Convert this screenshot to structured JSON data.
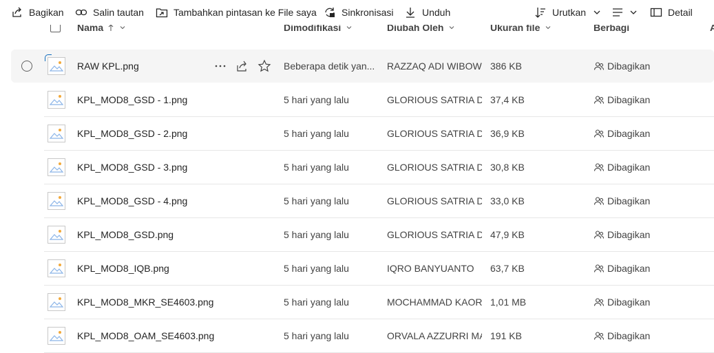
{
  "toolbar": {
    "share": "Bagikan",
    "copy_link": "Salin tautan",
    "add_shortcut": "Tambahkan pintasan ke File saya",
    "sync": "Sinkronisasi",
    "download": "Unduh",
    "sort": "Urutkan",
    "view_icon": "list-view-icon",
    "details": "Detail"
  },
  "columns": {
    "name": "Nama",
    "modified": "Dimodifikasi",
    "modified_by": "Diubah Oleh",
    "size": "Ukuran file",
    "sharing": "Berbagi",
    "extra": "A"
  },
  "rows": [
    {
      "name": "RAW KPL.png",
      "modified": "Beberapa detik yan...",
      "modified_by": "RAZZAQ ADI WIBOWO",
      "size": "386 KB",
      "sharing": "Dibagikan"
    },
    {
      "name": "KPL_MOD8_GSD - 1.png",
      "modified": "5 hari yang lalu",
      "modified_by": "GLORIOUS SATRIA DH",
      "size": "37,4 KB",
      "sharing": "Dibagikan"
    },
    {
      "name": "KPL_MOD8_GSD - 2.png",
      "modified": "5 hari yang lalu",
      "modified_by": "GLORIOUS SATRIA DH",
      "size": "36,9 KB",
      "sharing": "Dibagikan"
    },
    {
      "name": "KPL_MOD8_GSD - 3.png",
      "modified": "5 hari yang lalu",
      "modified_by": "GLORIOUS SATRIA DH",
      "size": "30,8 KB",
      "sharing": "Dibagikan"
    },
    {
      "name": "KPL_MOD8_GSD - 4.png",
      "modified": "5 hari yang lalu",
      "modified_by": "GLORIOUS SATRIA DH",
      "size": "33,0 KB",
      "sharing": "Dibagikan"
    },
    {
      "name": "KPL_MOD8_GSD.png",
      "modified": "5 hari yang lalu",
      "modified_by": "GLORIOUS SATRIA DH",
      "size": "47,9 KB",
      "sharing": "Dibagikan"
    },
    {
      "name": "KPL_MOD8_IQB.png",
      "modified": "5 hari yang lalu",
      "modified_by": "IQRO BANYUANTO",
      "size": "63,7 KB",
      "sharing": "Dibagikan"
    },
    {
      "name": "KPL_MOD8_MKR_SE4603.png",
      "modified": "5 hari yang lalu",
      "modified_by": "MOCHAMMAD KAORI",
      "size": "1,01 MB",
      "sharing": "Dibagikan"
    },
    {
      "name": "KPL_MOD8_OAM_SE4603.png",
      "modified": "5 hari yang lalu",
      "modified_by": "ORVALA AZZURRI MA",
      "size": "191 KB",
      "sharing": "Dibagikan"
    }
  ],
  "colors": {
    "accent": "#0f6cbd",
    "thumb_sun": "#f2a93b",
    "thumb_hill": "#8ab4e8"
  }
}
